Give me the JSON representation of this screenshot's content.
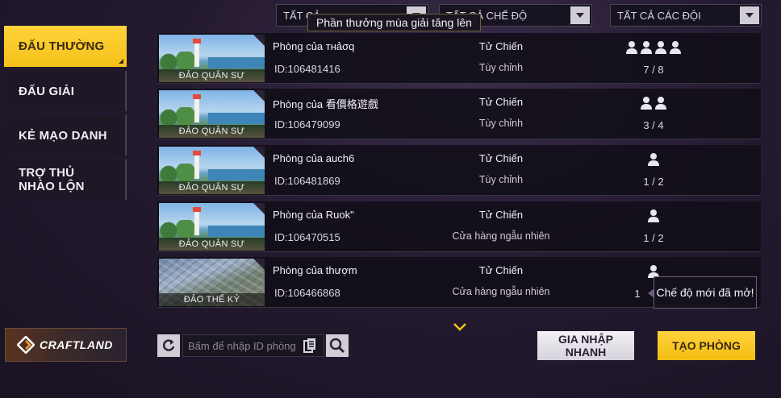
{
  "filters": {
    "all": "TẤT CẢ",
    "all_modes": "TẤT CẢ CHẾ ĐỘ",
    "all_teams": "TẤT CẢ CÁC ĐỘI"
  },
  "banner_tooltip": "Phần thưởng mùa giải tăng lên",
  "sidebar": {
    "tabs": [
      {
        "label": "ĐẤU THƯỜNG",
        "active": true
      },
      {
        "label": "ĐẤU GIẢI",
        "active": false
      },
      {
        "label": "KẺ MẠO DANH",
        "active": false
      },
      {
        "label": "TRỢ THỦ NHÀO LỘN",
        "active": false
      }
    ]
  },
  "rooms": [
    {
      "map": "ĐẢO QUÂN SỰ",
      "name": "Phòng của тнảσq",
      "id": "ID:106481416",
      "mode": "Tử Chiến",
      "submode": "Tùy chỉnh",
      "players": "7 / 8",
      "icons": 4
    },
    {
      "map": "ĐẢO QUÂN SỰ",
      "name": "Phòng của 看價格遊戲",
      "id": "ID:106479099",
      "mode": "Tử Chiến",
      "submode": "Tùy chỉnh",
      "players": "3 / 4",
      "icons": 2
    },
    {
      "map": "ĐẢO QUÂN SỰ",
      "name": "Phòng của auch6",
      "id": "ID:106481869",
      "mode": "Tử Chiến",
      "submode": "Tùy chỉnh",
      "players": "1 / 2",
      "icons": 1
    },
    {
      "map": "ĐẢO QUÂN SỰ",
      "name": "Phòng của Ruok\"",
      "id": "ID:106470515",
      "mode": "Tử Chiến",
      "submode": "Cửa hàng ngẫu nhiên",
      "players": "1 / 2",
      "icons": 1
    },
    {
      "map": "ĐẢO THẾ KỶ",
      "name": "Phòng của thượm",
      "id": "ID:106466868",
      "mode": "Tử Chiến",
      "submode": "Cửa hàng ngẫu nhiên",
      "players": "1",
      "icons": 1
    }
  ],
  "new_mode_tooltip": "Chế độ mới đã mở!",
  "craftland_label": "CRAFTLAND",
  "search": {
    "placeholder": "Bấm để nhập ID phòng"
  },
  "actions": {
    "quick_join": "GIA NHẬP NHANH",
    "create_room": "TẠO PHÒNG"
  },
  "colors": {
    "accent": "#f5c21a",
    "background": "#241a30"
  }
}
